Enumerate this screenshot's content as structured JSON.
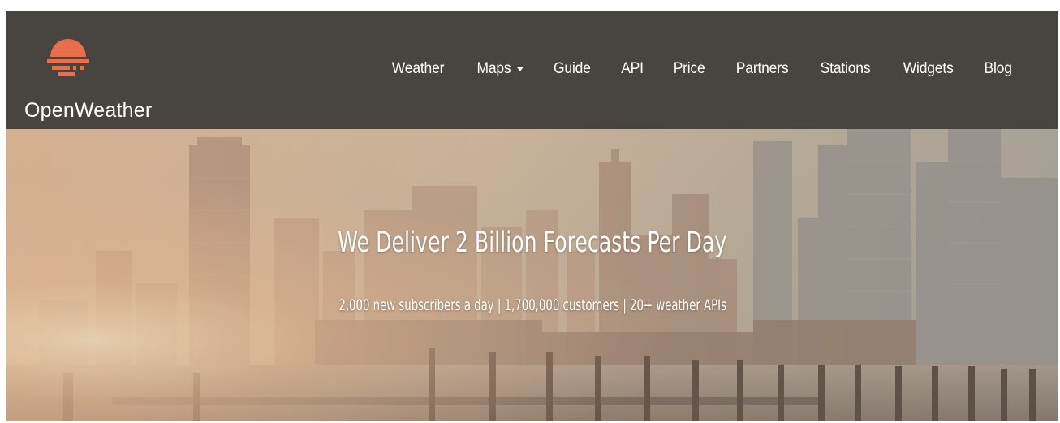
{
  "brand": {
    "name": "OpenWeather",
    "logo_icon": "sun-over-sea-icon",
    "accent_color": "#eb6e4b"
  },
  "nav": {
    "items": [
      {
        "label": "Weather"
      },
      {
        "label": "Maps",
        "has_dropdown": true
      },
      {
        "label": "Guide"
      },
      {
        "label": "API"
      },
      {
        "label": "Price"
      },
      {
        "label": "Partners"
      },
      {
        "label": "Stations"
      },
      {
        "label": "Widgets"
      },
      {
        "label": "Blog"
      }
    ]
  },
  "hero": {
    "headline": "We Deliver 2 Billion Forecasts Per Day",
    "subheadline": "2,000 new subscribers a day | 1,700,000 customers | 20+ weather APIs",
    "background": "city-skyline-image"
  },
  "colors": {
    "header_bg": "#48443f",
    "text": "#ffffff"
  }
}
